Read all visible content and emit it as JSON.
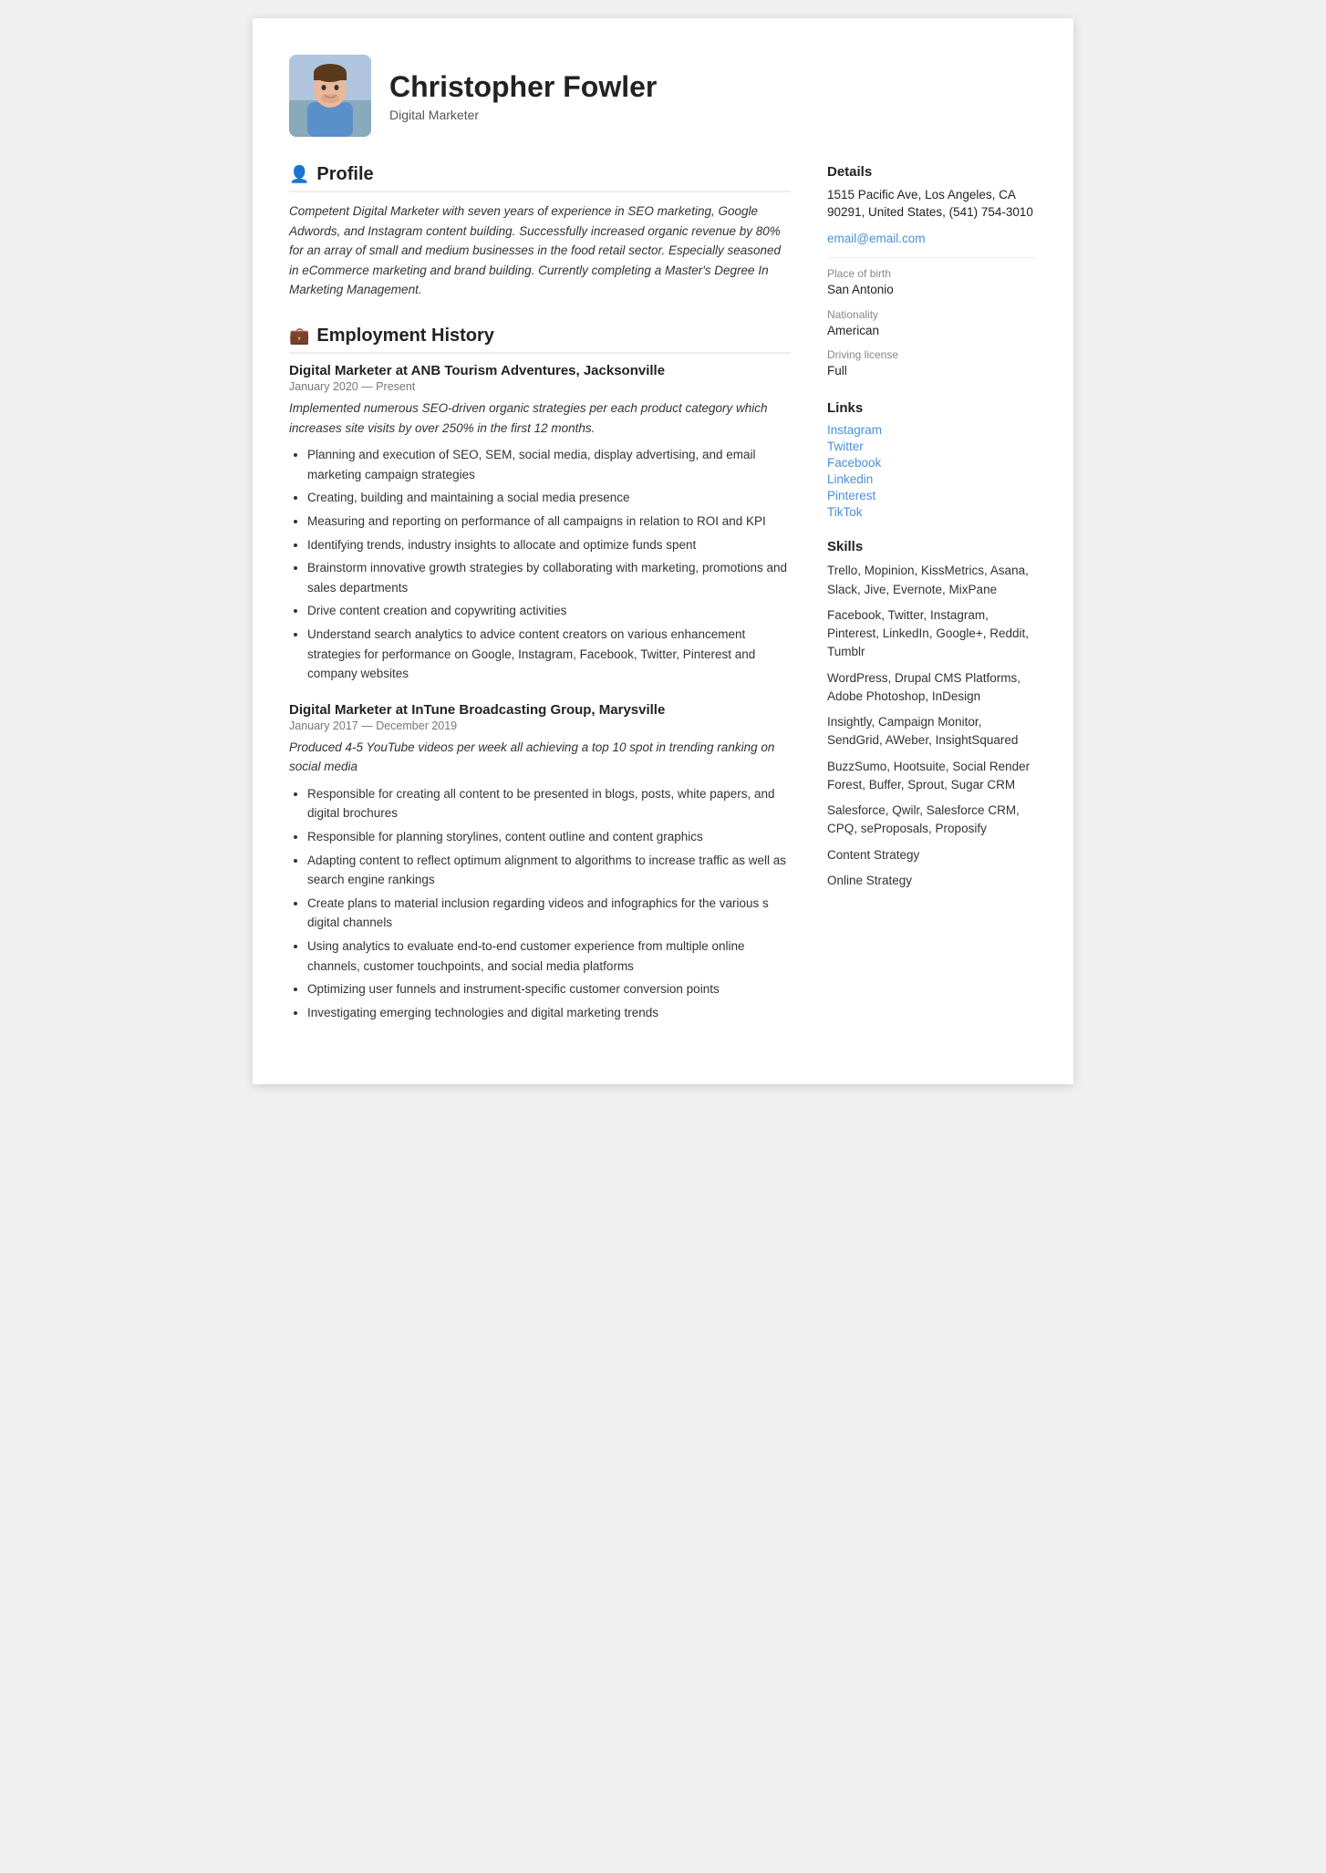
{
  "header": {
    "name": "Christopher Fowler",
    "subtitle": "Digital Marketer"
  },
  "profile": {
    "section_title": "Profile",
    "text": "Competent Digital Marketer with seven years of experience in SEO marketing, Google Adwords, and Instagram content building. Successfully increased organic revenue by 80% for an array of small and medium businesses in the food retail sector. Especially seasoned in eCommerce marketing and brand building. Currently completing a Master's Degree In Marketing Management."
  },
  "employment": {
    "section_title": "Employment History",
    "jobs": [
      {
        "title": "Digital Marketer at  ANB Tourism Adventures, Jacksonville",
        "dates": "January 2020 — Present",
        "summary": "Implemented numerous SEO-driven organic strategies per each product category which increases site visits by over 250% in the first 12 months.",
        "bullets": [
          "Planning and execution of SEO, SEM, social media, display advertising, and email marketing campaign strategies",
          "Creating, building and maintaining a social media presence",
          "Measuring and reporting on performance of all campaigns in relation to ROI and KPI",
          "Identifying trends, industry insights to allocate and optimize funds spent",
          "Brainstorm innovative growth strategies by collaborating with marketing, promotions and sales departments",
          "Drive content creation and copywriting activities",
          "Understand search analytics to advice content creators on various enhancement strategies for performance on Google, Instagram, Facebook, Twitter, Pinterest and company websites"
        ]
      },
      {
        "title": "Digital Marketer at  InTune Broadcasting Group, Marysville",
        "dates": "January 2017 — December 2019",
        "summary": "Produced 4-5 YouTube videos per week all achieving a top 10 spot in trending ranking on social media",
        "bullets": [
          "Responsible for creating all content to be presented in blogs, posts, white papers, and digital brochures",
          "Responsible for planning storylines, content outline and content graphics",
          "Adapting content to reflect optimum alignment to algorithms to increase traffic as well as search engine rankings",
          "Create plans to material inclusion regarding videos and infographics for the various s digital channels",
          "Using analytics to evaluate end-to-end customer experience from multiple online channels, customer touchpoints, and social media platforms",
          "Optimizing user funnels and instrument-specific customer conversion points",
          "Investigating emerging technologies and digital marketing trends"
        ]
      }
    ]
  },
  "sidebar": {
    "details_title": "Details",
    "address": "1515 Pacific Ave, Los Angeles, CA 90291, United States, (541) 754-3010",
    "email": "email@email.com",
    "place_of_birth_label": "Place of birth",
    "place_of_birth": "San Antonio",
    "nationality_label": "Nationality",
    "nationality": "American",
    "driving_license_label": "Driving license",
    "driving_license": "Full",
    "links_title": "Links",
    "links": [
      "Instagram",
      "Twitter",
      "Facebook",
      "Linkedin",
      "Pinterest",
      "TikTok"
    ],
    "skills_title": "Skills",
    "skills": [
      "Trello, Mopinion, KissMetrics, Asana, Slack, Jive, Evernote, MixPane",
      "Facebook, Twitter, Instagram, Pinterest, LinkedIn, Google+, Reddit, Tumblr",
      "WordPress, Drupal CMS Platforms, Adobe Photoshop, InDesign",
      "Insightly, Campaign Monitor, SendGrid, AWeber, InsightSquared",
      "BuzzSumo, Hootsuite, Social Render Forest, Buffer, Sprout, Sugar CRM",
      "Salesforce, Qwilr, Salesforce CRM, CPQ, seProposals, Proposify",
      "Content Strategy",
      "Online Strategy"
    ]
  }
}
